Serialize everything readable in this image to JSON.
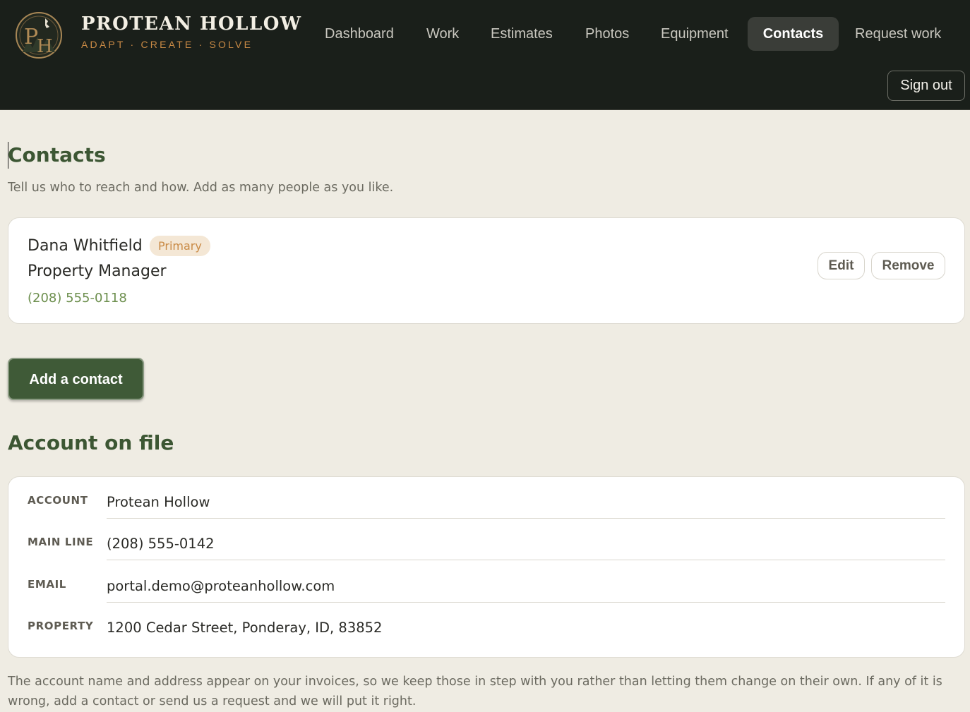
{
  "brand": {
    "name": "PROTEAN HOLLOW",
    "tagline": "ADAPT · CREATE · SOLVE",
    "logo_icon": "ph-monogram-logo",
    "logo_letters": "PH"
  },
  "nav": {
    "items": [
      {
        "label": "Dashboard",
        "active": false
      },
      {
        "label": "Work",
        "active": false
      },
      {
        "label": "Estimates",
        "active": false
      },
      {
        "label": "Photos",
        "active": false
      },
      {
        "label": "Equipment",
        "active": false
      },
      {
        "label": "Contacts",
        "active": true
      },
      {
        "label": "Request work",
        "active": false
      }
    ],
    "sign_out": "Sign out"
  },
  "page": {
    "title": "Contacts",
    "lead": "Tell us who to reach and how. Add as many people as you like."
  },
  "contacts": [
    {
      "name": "Dana Whitfield",
      "badge": "Primary",
      "role": "Property Manager",
      "phone": "(208) 555-0118",
      "edit_label": "Edit",
      "remove_label": "Remove"
    }
  ],
  "add_contact_label": "Add a contact",
  "account": {
    "title": "Account on file",
    "rows": [
      {
        "label": "ACCOUNT",
        "value": "Protean Hollow"
      },
      {
        "label": "MAIN LINE",
        "value": "(208) 555-0142"
      },
      {
        "label": "EMAIL",
        "value": "portal.demo@proteanhollow.com"
      },
      {
        "label": "PROPERTY",
        "value": "1200 Cedar Street, Ponderay, ID, 83852"
      }
    ],
    "footnote": "The account name and address appear on your invoices, so we keep those in step with you rather than letting them change on their own. If any of it is wrong, add a contact or send us a request and we will put it right."
  },
  "colors": {
    "header_bg": "#1a1f1a",
    "page_bg": "#efece3",
    "accent_green": "#3c5633",
    "accent_orange": "#c98a45",
    "phone_green": "#6d8f4e"
  }
}
